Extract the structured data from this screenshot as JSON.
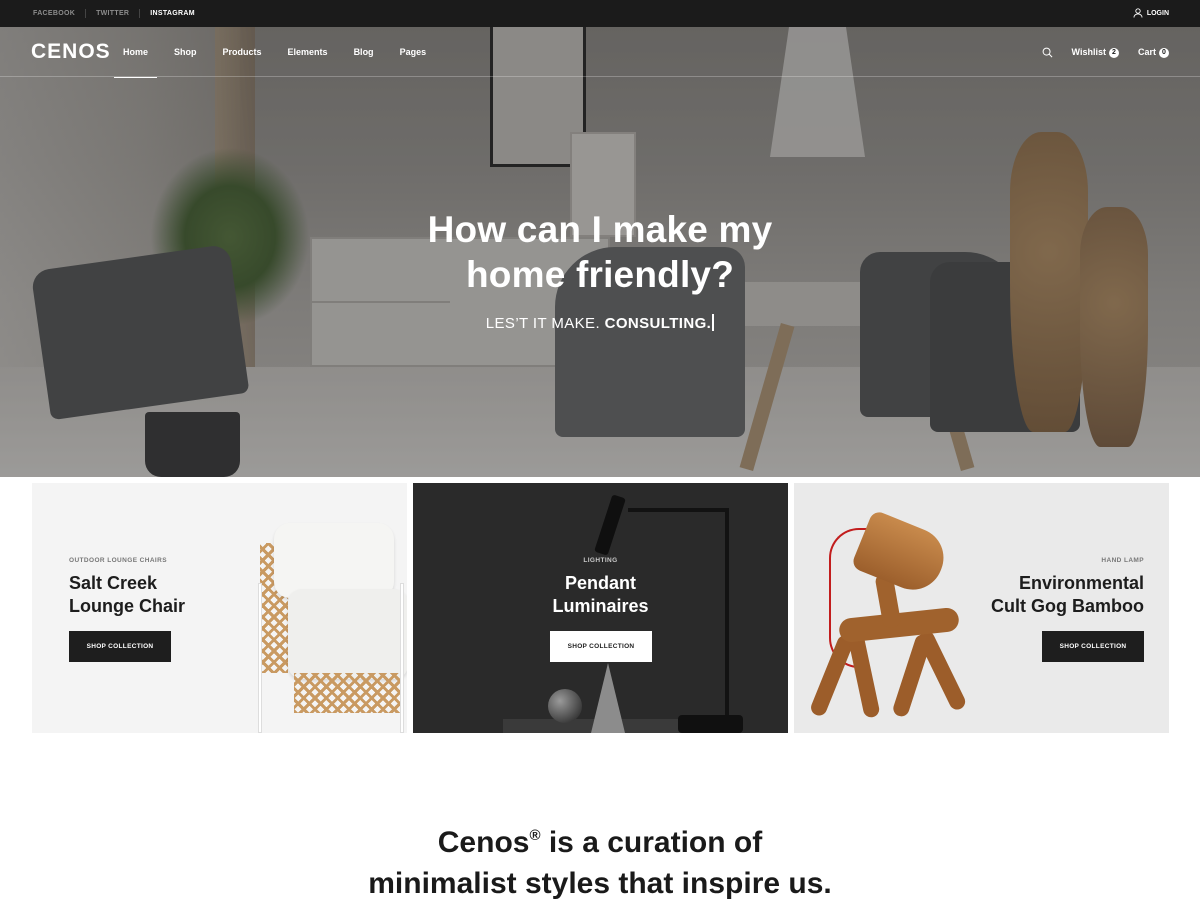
{
  "topbar": {
    "social": [
      {
        "label": "FACEBOOK",
        "active": false
      },
      {
        "label": "TWITTER",
        "active": false
      },
      {
        "label": "INSTAGRAM",
        "active": true
      }
    ],
    "login_label": "LOGIN"
  },
  "nav": {
    "logo": "CENOS",
    "menu": [
      {
        "label": "Home",
        "active": true
      },
      {
        "label": "Shop",
        "active": false
      },
      {
        "label": "Products",
        "active": false
      },
      {
        "label": "Elements",
        "active": false
      },
      {
        "label": "Blog",
        "active": false
      },
      {
        "label": "Pages",
        "active": false
      }
    ],
    "wishlist_label": "Wishlist",
    "wishlist_count": "2",
    "cart_label": "Cart",
    "cart_count": "0",
    "icons": {
      "search": "search-icon",
      "user": "user-icon"
    }
  },
  "hero": {
    "heading_line1": "How can I make my",
    "heading_line2": "home friendly?",
    "sub_prefix": "LES’T IT MAKE.",
    "sub_bold": "CONSULTING."
  },
  "cards": [
    {
      "kicker": "OUTDOOR LOUNGE CHAIRS",
      "title_line1": "Salt Creek",
      "title_line2": "Lounge Chair",
      "button": "SHOP COLLECTION",
      "background": "#f4f4f4"
    },
    {
      "kicker": "LIGHTING",
      "title_line1": "Pendant",
      "title_line2": "Luminaires",
      "button": "SHOP COLLECTION",
      "background": "#2a2a2a"
    },
    {
      "kicker": "HAND LAMP",
      "title_line1": "Environmental",
      "title_line2": "Cult Gog Bamboo",
      "button": "SHOP COLLECTION",
      "background": "#eaeaea"
    }
  ],
  "tagline": {
    "brand": "Cenos",
    "mark": "®",
    "line1_rest": " is a curation of",
    "line2": "minimalist styles that inspire us."
  },
  "colors": {
    "topbar": "#1b1b1b",
    "accent_dark": "#1e1e1e",
    "text": "#1a1a1a"
  }
}
